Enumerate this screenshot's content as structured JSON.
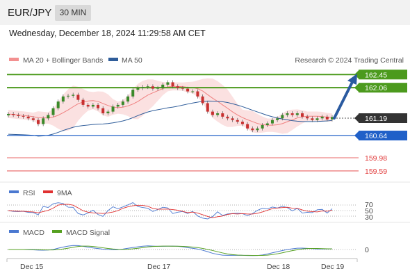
{
  "header": {
    "symbol": "EUR/JPY",
    "timeframe": "30 MIN",
    "datetime": "Wednesday, December 18, 2024 11:29:58 AM CET"
  },
  "chart_data": {
    "type": "candlestick",
    "title": "EUR/JPY",
    "legend": {
      "bb": "MA 20 + Bollinger Bands",
      "ma50": "MA 50",
      "credit": "Research © 2024 Trading Central"
    },
    "y_range": [
      159.3,
      162.6
    ],
    "x_labels": [
      "Dec 15",
      "Dec 17",
      "Dec 18",
      "Dec 19"
    ],
    "last_price": "161.19",
    "levels": [
      {
        "value": "162.45",
        "color": "#4c9a1d",
        "type": "target"
      },
      {
        "value": "162.06",
        "color": "#4c9a1d",
        "type": "target"
      },
      {
        "value": "160.64",
        "color": "#2060c8",
        "type": "pivot"
      },
      {
        "value": "159.98",
        "color": "#e03535",
        "type": "support"
      },
      {
        "value": "159.59",
        "color": "#e03535",
        "type": "support"
      }
    ],
    "close_series": [
      161.28,
      161.25,
      161.22,
      161.2,
      161.15,
      161.1,
      160.98,
      161.15,
      161.25,
      161.45,
      161.65,
      161.8,
      161.82,
      161.85,
      161.7,
      161.55,
      161.5,
      161.55,
      161.45,
      161.3,
      161.35,
      161.5,
      161.55,
      161.65,
      161.8,
      162.0,
      162.05,
      162.08,
      162.1,
      162.03,
      162.05,
      162.15,
      162.22,
      162.1,
      162.05,
      162.03,
      161.95,
      161.95,
      161.8,
      161.6,
      161.35,
      161.25,
      161.3,
      161.2,
      161.15,
      161.1,
      161.05,
      160.98,
      160.85,
      160.8,
      160.85,
      160.95,
      161.0,
      161.1,
      161.15,
      161.25,
      161.3,
      161.25,
      161.3,
      161.2,
      161.15,
      161.1,
      161.15,
      161.2,
      161.12,
      161.19
    ],
    "rsi": {
      "title": "RSI",
      "ma_label": "9MA",
      "levels": [
        "70",
        "50",
        "30"
      ]
    },
    "macd": {
      "title": "MACD",
      "signal_label": "MACD Signal",
      "zero_label": "0"
    }
  }
}
